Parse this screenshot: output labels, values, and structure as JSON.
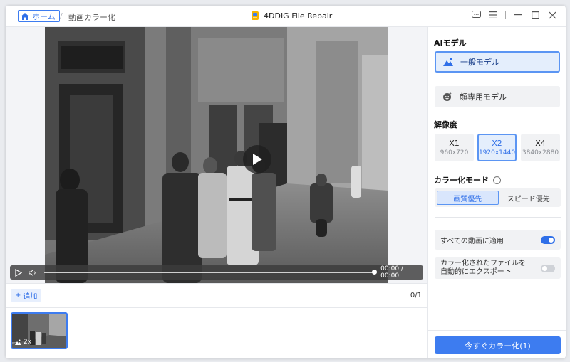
{
  "titlebar": {
    "home_label": "ホーム",
    "separator": "/",
    "current_page": "動画カラー化",
    "app_name": "4DDIG File Repair"
  },
  "player": {
    "time": "00:00 / 00:00",
    "progress": 1.0
  },
  "files": {
    "add_label": "追加",
    "count": "0/1",
    "thumbnails": [
      {
        "badge": "2x"
      }
    ]
  },
  "panel": {
    "ai_model_title": "AIモデル",
    "models": [
      {
        "label": "一般モデル",
        "active": true
      },
      {
        "label": "顔専用モデル",
        "active": false
      }
    ],
    "resolution_title": "解像度",
    "resolutions": [
      {
        "label": "X1",
        "size": "960x720",
        "active": false
      },
      {
        "label": "X2",
        "size": "1920x1440",
        "active": true
      },
      {
        "label": "X4",
        "size": "3840x2880",
        "active": false
      }
    ],
    "mode_title": "カラー化モード",
    "modes": [
      {
        "label": "画質優先",
        "active": true
      },
      {
        "label": "スピード優先",
        "active": false
      }
    ],
    "apply_all_label": "すべての動画に適用",
    "apply_all_on": true,
    "auto_export_line1": "カラー化されたファイルを",
    "auto_export_line2": "自動的にエクスポート",
    "auto_export_on": false,
    "action_label": "今すぐカラー化(1)"
  },
  "colors": {
    "accent": "#3d7cf0",
    "accent_light": "#e4eefc"
  }
}
